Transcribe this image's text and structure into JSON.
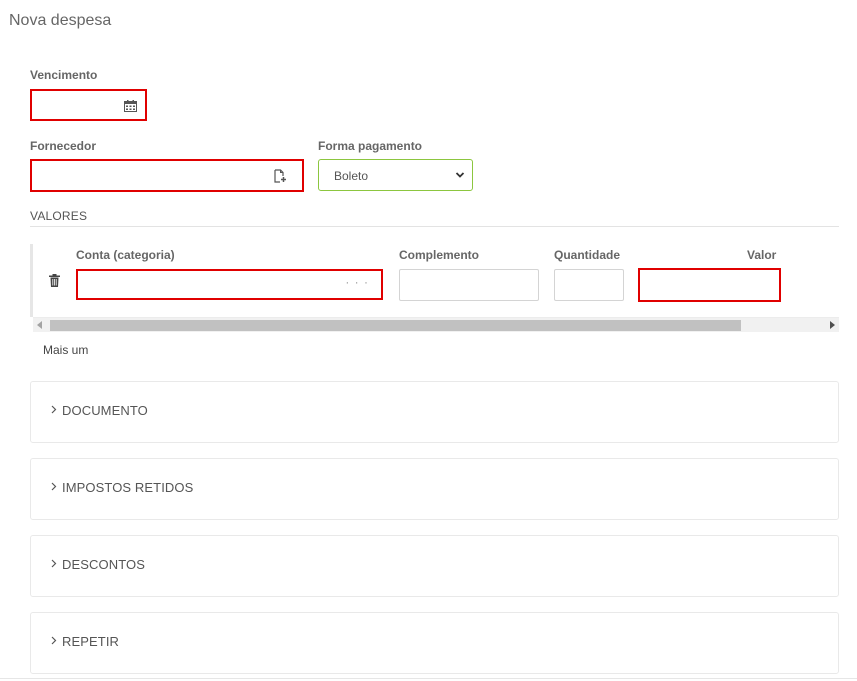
{
  "page": {
    "title": "Nova despesa"
  },
  "form": {
    "vencimento": {
      "label": "Vencimento",
      "value": "",
      "icon": "calendar-icon"
    },
    "fornecedor": {
      "label": "Fornecedor",
      "value": "",
      "icon": "add-document-icon"
    },
    "forma_pagamento": {
      "label": "Forma pagamento",
      "selected": "Boleto"
    }
  },
  "valores": {
    "title": "VALORES",
    "columns": {
      "conta": "Conta (categoria)",
      "complemento": "Complemento",
      "quantidade": "Quantidade",
      "valor": "Valor"
    },
    "rows": [
      {
        "conta": "",
        "more": "· · ·",
        "complemento": "",
        "quantidade": "",
        "valor": ""
      }
    ],
    "add_label": "Mais um"
  },
  "sections": [
    {
      "label": "DOCUMENTO"
    },
    {
      "label": "IMPOSTOS RETIDOS"
    },
    {
      "label": "DESCONTOS"
    },
    {
      "label": "REPETIR"
    }
  ],
  "colors": {
    "error_border": "#e00000",
    "select_border": "#8cc63f",
    "text": "#555555"
  }
}
